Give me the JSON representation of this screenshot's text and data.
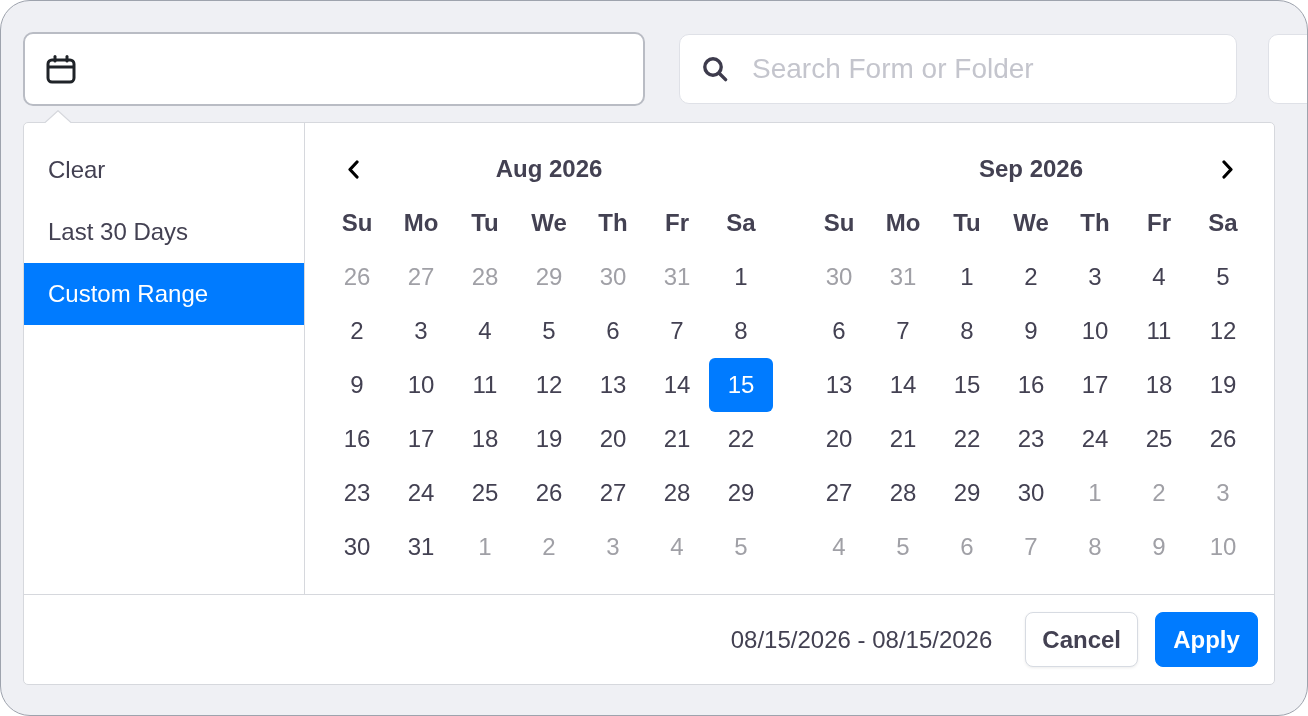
{
  "search_field": {
    "placeholder": "Search Form or Folder"
  },
  "ranges": [
    {
      "label": "Clear",
      "selected": false
    },
    {
      "label": "Last 30 Days",
      "selected": false
    },
    {
      "label": "Custom Range",
      "selected": true
    }
  ],
  "calendars": [
    {
      "title": "Aug 2026",
      "weekdays": [
        "Su",
        "Mo",
        "Tu",
        "We",
        "Th",
        "Fr",
        "Sa"
      ],
      "days": [
        {
          "day": "26",
          "outside_month": true,
          "selected": false
        },
        {
          "day": "27",
          "outside_month": true,
          "selected": false
        },
        {
          "day": "28",
          "outside_month": true,
          "selected": false
        },
        {
          "day": "29",
          "outside_month": true,
          "selected": false
        },
        {
          "day": "30",
          "outside_month": true,
          "selected": false
        },
        {
          "day": "31",
          "outside_month": true,
          "selected": false
        },
        {
          "day": "1",
          "outside_month": false,
          "selected": false
        },
        {
          "day": "2",
          "outside_month": false,
          "selected": false
        },
        {
          "day": "3",
          "outside_month": false,
          "selected": false
        },
        {
          "day": "4",
          "outside_month": false,
          "selected": false
        },
        {
          "day": "5",
          "outside_month": false,
          "selected": false
        },
        {
          "day": "6",
          "outside_month": false,
          "selected": false
        },
        {
          "day": "7",
          "outside_month": false,
          "selected": false
        },
        {
          "day": "8",
          "outside_month": false,
          "selected": false
        },
        {
          "day": "9",
          "outside_month": false,
          "selected": false
        },
        {
          "day": "10",
          "outside_month": false,
          "selected": false
        },
        {
          "day": "11",
          "outside_month": false,
          "selected": false
        },
        {
          "day": "12",
          "outside_month": false,
          "selected": false
        },
        {
          "day": "13",
          "outside_month": false,
          "selected": false
        },
        {
          "day": "14",
          "outside_month": false,
          "selected": false
        },
        {
          "day": "15",
          "outside_month": false,
          "selected": true
        },
        {
          "day": "16",
          "outside_month": false,
          "selected": false
        },
        {
          "day": "17",
          "outside_month": false,
          "selected": false
        },
        {
          "day": "18",
          "outside_month": false,
          "selected": false
        },
        {
          "day": "19",
          "outside_month": false,
          "selected": false
        },
        {
          "day": "20",
          "outside_month": false,
          "selected": false
        },
        {
          "day": "21",
          "outside_month": false,
          "selected": false
        },
        {
          "day": "22",
          "outside_month": false,
          "selected": false
        },
        {
          "day": "23",
          "outside_month": false,
          "selected": false
        },
        {
          "day": "24",
          "outside_month": false,
          "selected": false
        },
        {
          "day": "25",
          "outside_month": false,
          "selected": false
        },
        {
          "day": "26",
          "outside_month": false,
          "selected": false
        },
        {
          "day": "27",
          "outside_month": false,
          "selected": false
        },
        {
          "day": "28",
          "outside_month": false,
          "selected": false
        },
        {
          "day": "29",
          "outside_month": false,
          "selected": false
        },
        {
          "day": "30",
          "outside_month": false,
          "selected": false
        },
        {
          "day": "31",
          "outside_month": false,
          "selected": false
        },
        {
          "day": "1",
          "outside_month": true,
          "selected": false
        },
        {
          "day": "2",
          "outside_month": true,
          "selected": false
        },
        {
          "day": "3",
          "outside_month": true,
          "selected": false
        },
        {
          "day": "4",
          "outside_month": true,
          "selected": false
        },
        {
          "day": "5",
          "outside_month": true,
          "selected": false
        }
      ]
    },
    {
      "title": "Sep 2026",
      "weekdays": [
        "Su",
        "Mo",
        "Tu",
        "We",
        "Th",
        "Fr",
        "Sa"
      ],
      "days": [
        {
          "day": "30",
          "outside_month": true,
          "selected": false
        },
        {
          "day": "31",
          "outside_month": true,
          "selected": false
        },
        {
          "day": "1",
          "outside_month": false,
          "selected": false
        },
        {
          "day": "2",
          "outside_month": false,
          "selected": false
        },
        {
          "day": "3",
          "outside_month": false,
          "selected": false
        },
        {
          "day": "4",
          "outside_month": false,
          "selected": false
        },
        {
          "day": "5",
          "outside_month": false,
          "selected": false
        },
        {
          "day": "6",
          "outside_month": false,
          "selected": false
        },
        {
          "day": "7",
          "outside_month": false,
          "selected": false
        },
        {
          "day": "8",
          "outside_month": false,
          "selected": false
        },
        {
          "day": "9",
          "outside_month": false,
          "selected": false
        },
        {
          "day": "10",
          "outside_month": false,
          "selected": false
        },
        {
          "day": "11",
          "outside_month": false,
          "selected": false
        },
        {
          "day": "12",
          "outside_month": false,
          "selected": false
        },
        {
          "day": "13",
          "outside_month": false,
          "selected": false
        },
        {
          "day": "14",
          "outside_month": false,
          "selected": false
        },
        {
          "day": "15",
          "outside_month": false,
          "selected": false
        },
        {
          "day": "16",
          "outside_month": false,
          "selected": false
        },
        {
          "day": "17",
          "outside_month": false,
          "selected": false
        },
        {
          "day": "18",
          "outside_month": false,
          "selected": false
        },
        {
          "day": "19",
          "outside_month": false,
          "selected": false
        },
        {
          "day": "20",
          "outside_month": false,
          "selected": false
        },
        {
          "day": "21",
          "outside_month": false,
          "selected": false
        },
        {
          "day": "22",
          "outside_month": false,
          "selected": false
        },
        {
          "day": "23",
          "outside_month": false,
          "selected": false
        },
        {
          "day": "24",
          "outside_month": false,
          "selected": false
        },
        {
          "day": "25",
          "outside_month": false,
          "selected": false
        },
        {
          "day": "26",
          "outside_month": false,
          "selected": false
        },
        {
          "day": "27",
          "outside_month": false,
          "selected": false
        },
        {
          "day": "28",
          "outside_month": false,
          "selected": false
        },
        {
          "day": "29",
          "outside_month": false,
          "selected": false
        },
        {
          "day": "30",
          "outside_month": false,
          "selected": false
        },
        {
          "day": "1",
          "outside_month": true,
          "selected": false
        },
        {
          "day": "2",
          "outside_month": true,
          "selected": false
        },
        {
          "day": "3",
          "outside_month": true,
          "selected": false
        },
        {
          "day": "4",
          "outside_month": true,
          "selected": false
        },
        {
          "day": "5",
          "outside_month": true,
          "selected": false
        },
        {
          "day": "6",
          "outside_month": true,
          "selected": false
        },
        {
          "day": "7",
          "outside_month": true,
          "selected": false
        },
        {
          "day": "8",
          "outside_month": true,
          "selected": false
        },
        {
          "day": "9",
          "outside_month": true,
          "selected": false
        },
        {
          "day": "10",
          "outside_month": true,
          "selected": false
        }
      ]
    }
  ],
  "footer": {
    "range_text": "08/15/2026 - 08/15/2026",
    "buttons": [
      {
        "label": "Cancel",
        "kind": "cancel"
      },
      {
        "label": "Apply",
        "kind": "apply"
      }
    ]
  }
}
